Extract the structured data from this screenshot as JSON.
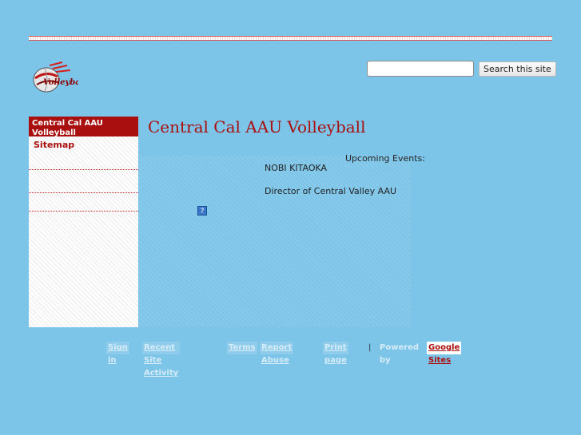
{
  "site": {
    "logo_alt": "Volleyball",
    "title": "Central Cal AAU Volleyball"
  },
  "search": {
    "value": "",
    "placeholder": "",
    "button_label": "Search this site"
  },
  "sidebar": {
    "items": [
      {
        "label": "Central Cal AAU Volleyball",
        "selected": true
      },
      {
        "label": "Sitemap",
        "selected": false
      }
    ]
  },
  "main": {
    "upcoming_label": "Upcoming Events:",
    "name": "NOBI KITAOKA",
    "role": "Director of Central Valley AAU",
    "help_icon": "?"
  },
  "footer": {
    "sign_in": "Sign in",
    "recent_activity": "Recent Site Activity",
    "terms": "Terms",
    "report_abuse": "Report Abuse",
    "print_page": "Print page",
    "separator": "|",
    "powered_by": "Powered by",
    "google_sites": "Google Sites"
  },
  "colors": {
    "background": "#7cc4e8",
    "accent": "#aa0f0f"
  }
}
